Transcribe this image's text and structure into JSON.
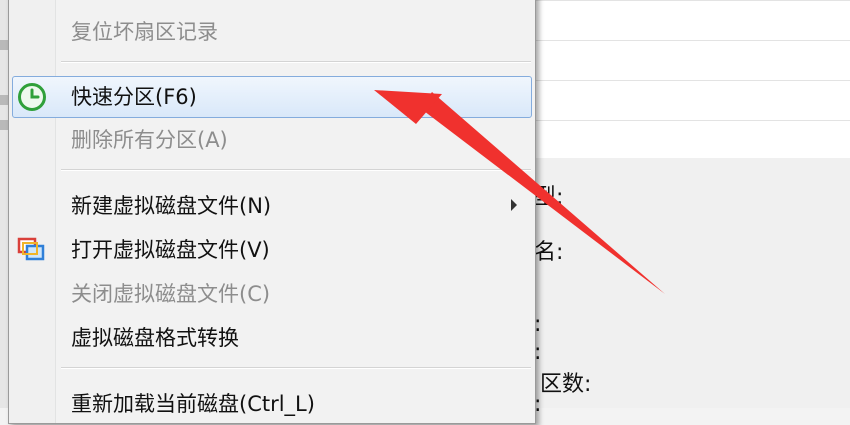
{
  "background": {
    "labels": [
      "型:",
      "名:",
      ":",
      ":",
      "区数:",
      ":"
    ]
  },
  "menu": {
    "items": [
      {
        "label": "复位坏扇区记录",
        "disabled": true
      },
      {
        "label": "快速分区(F6)",
        "disabled": false,
        "highlighted": true,
        "icon": "clock-icon"
      },
      {
        "label": "删除所有分区(A)",
        "disabled": true
      },
      {
        "label": "新建虚拟磁盘文件(N)",
        "disabled": false,
        "submenu": true
      },
      {
        "label": "打开虚拟磁盘文件(V)",
        "disabled": false,
        "icon": "open-disk-icon"
      },
      {
        "label": "关闭虚拟磁盘文件(C)",
        "disabled": true
      },
      {
        "label": "虚拟磁盘格式转换",
        "disabled": false
      },
      {
        "label": "重新加载当前磁盘(Ctrl_L)",
        "disabled": false
      }
    ]
  },
  "colors": {
    "annotation_arrow": "#f0312e",
    "highlight_border": "#84acdd"
  }
}
